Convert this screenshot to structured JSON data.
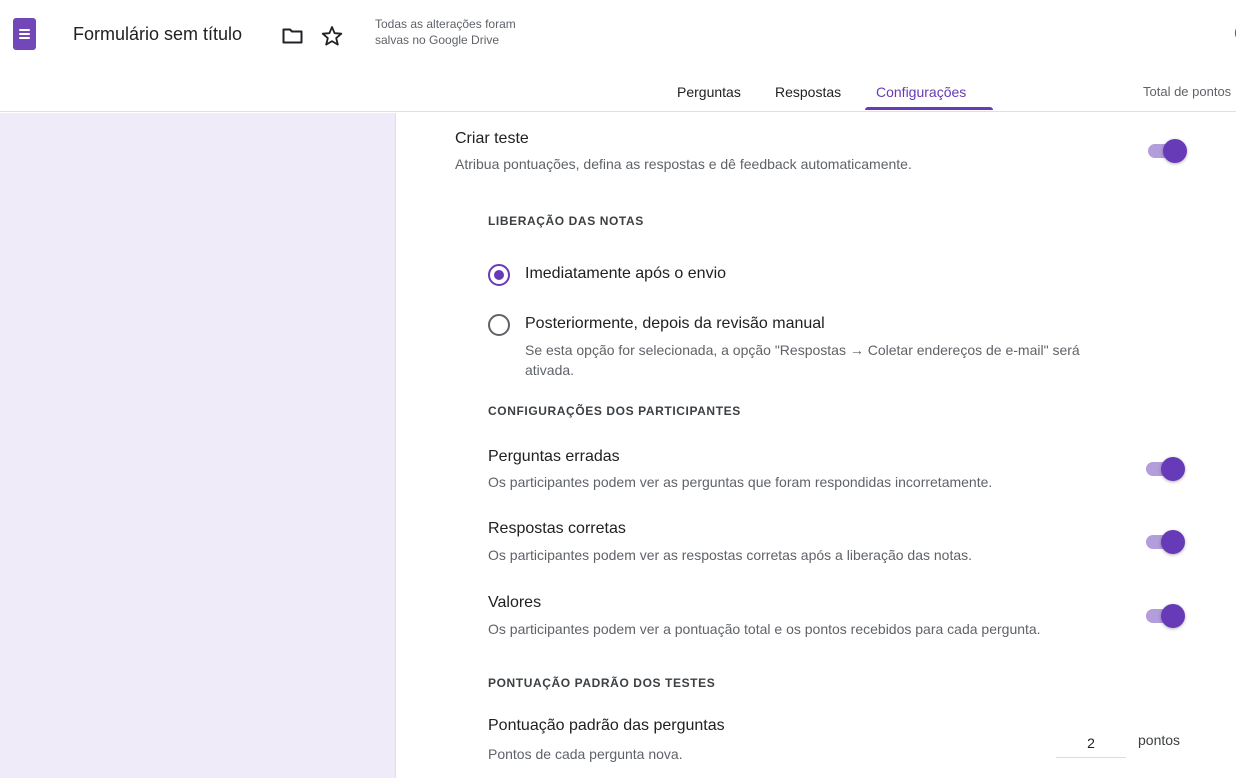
{
  "header": {
    "title": "Formulário sem título",
    "save_status_line1": "Todas as alterações foram",
    "save_status_line2": "salvas no Google Drive",
    "tabs": [
      {
        "label": "Perguntas"
      },
      {
        "label": "Respostas"
      },
      {
        "label": "Configurações",
        "active": true
      }
    ],
    "total_points_label": "Total de pontos",
    "accent_color": "#673ab7"
  },
  "settings": {
    "quiz": {
      "title": "Criar teste",
      "description": "Atribua pontuações, defina as respostas e dê feedback automaticamente.",
      "enabled": true
    },
    "release": {
      "section_label": "LIBERAÇÃO DAS NOTAS",
      "options": [
        {
          "label": "Imediatamente após o envio",
          "selected": true
        },
        {
          "label": "Posteriormente, depois da revisão manual",
          "selected": false,
          "note_line1": "Se esta opção for selecionada, a opção \"Respostas → Coletar endereços de e-mail\" será",
          "note_line2": "ativada."
        }
      ]
    },
    "respondent": {
      "section_label": "CONFIGURAÇÕES DOS PARTICIPANTES",
      "items": [
        {
          "title": "Perguntas erradas",
          "description": "Os participantes podem ver as perguntas que foram respondidas incorretamente.",
          "enabled": true
        },
        {
          "title": "Respostas corretas",
          "description": "Os participantes podem ver as respostas corretas após a liberação das notas.",
          "enabled": true
        },
        {
          "title": "Valores",
          "description": "Os participantes podem ver a pontuação total e os pontos recebidos para cada pergunta.",
          "enabled": true
        }
      ]
    },
    "default_points": {
      "section_label": "PONTUAÇÃO PADRÃO DOS TESTES",
      "title": "Pontuação padrão das perguntas",
      "description": "Pontos de cada pergunta nova.",
      "value": "2",
      "unit": "pontos"
    }
  }
}
